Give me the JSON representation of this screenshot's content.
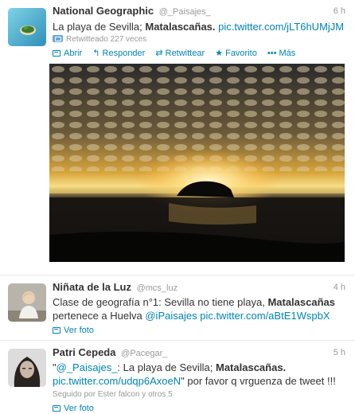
{
  "tweets": [
    {
      "fullname": "National Geographic",
      "username": "@_Paisajes_",
      "time": "6 h",
      "text_plain": "La playa de Sevilla; ",
      "text_bold": "Matalascañas.",
      "text_link": "pic.twitter.com/jLT6hUMjJM",
      "retweeted": "Retwitteado 227 veces",
      "actions": {
        "open": "Abrir",
        "reply": "Responder",
        "retweet": "Retwittear",
        "favorite": "Favorito",
        "more": "Más"
      }
    },
    {
      "fullname": "Niñata de la Luz",
      "username": "@mcs_luz",
      "time": "4 h",
      "line1_plain": "Clase de geografía n°1: Sevilla no tiene playa, ",
      "line1_bold": "Matalascañas",
      "line2_plain": "pertenece a Huelva ",
      "line2_link1": "@iPaisajes",
      "line2_link2": "pic.twitter.com/aBtE1WspbX",
      "action": "Ver foto"
    },
    {
      "fullname": "Patri Cepeda",
      "username": "@Pacegar_",
      "time": "5 h",
      "line1_link": "@_Paisajes_",
      "line1_plain": ": La playa de Sevilla; ",
      "line1_bold": "Matalascañas.",
      "line2_link": "pic.twitter.com/udqp6AxoeN",
      "line2_plain": "\" por favor q vrguenza de tweet !!!",
      "social": "Seguido por Ester falcon y otros 5",
      "action": "Ver foto"
    }
  ]
}
